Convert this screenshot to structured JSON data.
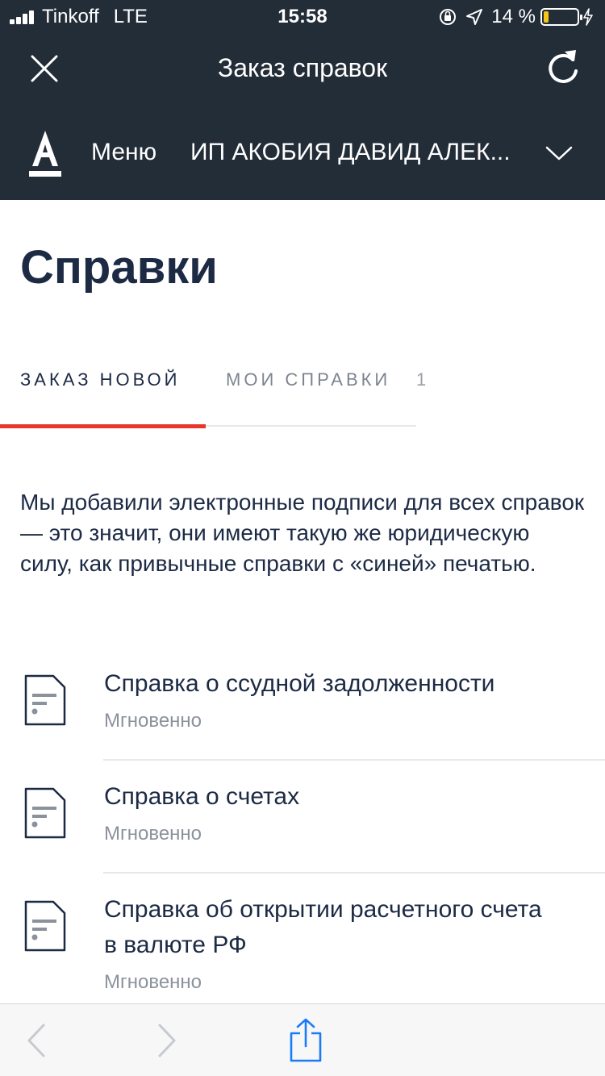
{
  "status_bar": {
    "carrier": "Tinkoff",
    "network": "LTE",
    "time": "15:58",
    "battery": "14 %",
    "battery_level": 0.14,
    "battery_color": "#f5c518"
  },
  "header": {
    "title": "Заказ справок",
    "menu_label": "Меню",
    "company": "ИП АКОБИЯ ДАВИД АЛЕК..."
  },
  "page": {
    "title": "Справки"
  },
  "tabs": {
    "new_label": "ЗАКАЗ НОВОЙ",
    "mine_label": "МОИ СПРАВКИ",
    "mine_count": "1",
    "accent_color": "#e8362a"
  },
  "notice": "Мы добавили электронные подписи для всех справок — это значит, они имеют такую же юридическую силу, как привычные справки с «синей» печатью.",
  "items": [
    {
      "title": "Справка о ссудной задолженности",
      "subtitle": "Мгновенно"
    },
    {
      "title": "Справка о счетах",
      "subtitle": "Мгновенно"
    },
    {
      "title": "Справка об открытии расчетного счета в валюте РФ",
      "subtitle": "Мгновенно"
    }
  ],
  "icons": {
    "close": "close-icon",
    "refresh": "refresh-icon",
    "logo": "alfa-logo",
    "chevron": "chevron-down-icon",
    "document": "document-icon",
    "back": "back-arrow-icon",
    "forward": "forward-arrow-icon",
    "share": "share-icon"
  }
}
